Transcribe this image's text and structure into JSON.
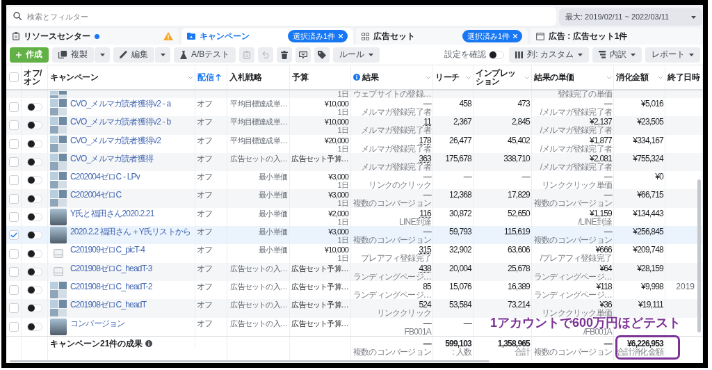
{
  "search": {
    "placeholder": "検索とフィルター"
  },
  "date_range": {
    "label": "最大: 2019/02/11 ~ 2022/03/11"
  },
  "tabs": [
    {
      "kind": "resources",
      "label": "リソースセンター",
      "selected": false,
      "notice": true,
      "warning": true
    },
    {
      "kind": "campaigns",
      "label": "キャンペーン",
      "selected": true,
      "notice": false,
      "warning": false,
      "badge": "選択済み1件"
    },
    {
      "kind": "adsets",
      "label": "広告セット",
      "selected": false,
      "notice": false,
      "warning": false,
      "badge": "選択済み1件"
    },
    {
      "kind": "ads",
      "label": "広告 : 広告セット1件",
      "selected": false,
      "notice": false,
      "warning": false
    }
  ],
  "toolbar": {
    "actions": [
      {
        "kind": "create",
        "label": "作成",
        "caret": false,
        "disabled": false
      },
      {
        "kind": "duplicate",
        "label": "複製",
        "caret": false,
        "disabled": false
      },
      {
        "kind": "dropdown",
        "disabled": false
      },
      {
        "kind": "edit",
        "label": "編集",
        "caret": false,
        "disabled": false
      },
      {
        "kind": "dropdown",
        "disabled": false
      },
      {
        "kind": "abtest",
        "label": "A/Bテスト",
        "caret": false,
        "disabled": false
      },
      {
        "kind": "clipboard",
        "caret": false,
        "disabled": true
      },
      {
        "kind": "undo",
        "caret": false,
        "disabled": true
      },
      {
        "kind": "delete",
        "caret": false,
        "disabled": false
      },
      {
        "kind": "comment",
        "caret": false,
        "disabled": false
      },
      {
        "kind": "tag",
        "caret": false,
        "disabled": false
      },
      {
        "kind": "rules",
        "label": "ルール",
        "caret": true,
        "disabled": false
      }
    ],
    "review": {
      "label": "設定を確認",
      "on": false
    },
    "views": [
      {
        "kind": "columns",
        "label": "列: カスタム"
      },
      {
        "kind": "breakdown",
        "label": "内訳"
      },
      {
        "kind": "reports",
        "label": "レポート"
      }
    ]
  },
  "table": {
    "select_all": {
      "checked": false
    },
    "columns": [
      {
        "label": "オフ/オン",
        "menu": false,
        "sorted": false,
        "info": false
      },
      {
        "label": "キャンペーン",
        "menu": true,
        "sorted": false,
        "info": false
      },
      {
        "label": "配信",
        "menu": false,
        "sorted": true,
        "info": false
      },
      {
        "label": "入札戦略",
        "menu": false,
        "sorted": false,
        "info": false
      },
      {
        "label": "予算",
        "menu": false,
        "sorted": false,
        "info": false
      },
      {
        "label": "結果",
        "menu": true,
        "sorted": false,
        "info": true
      },
      {
        "label": "リーチ",
        "menu": true,
        "sorted": false,
        "info": false
      },
      {
        "label": "インプレッション",
        "menu": true,
        "sorted": false,
        "info": false
      },
      {
        "label": "結果の単価",
        "menu": true,
        "sorted": false,
        "info": false
      },
      {
        "label": "消化金額",
        "menu": true,
        "sorted": false,
        "info": false
      },
      {
        "label": "終了日時",
        "menu": false,
        "sorted": false,
        "info": false
      }
    ],
    "cut_row": {
      "thumbnail": {
        "kind": "grid"
      },
      "budget": {
        "note": "1日"
      },
      "result": {
        "note": "ウェブサイトの登録…"
      },
      "cost": {
        "note": "登録完了の単価"
      }
    },
    "rows": [
      {
        "selected": false,
        "on": false,
        "thumbnail": {
          "kind": "grid"
        },
        "name": "CVO_メルマガ読者獲得v2 - a",
        "delivery": "オフ",
        "bid": "平均目標達成単…",
        "budget": {
          "value": "¥10,000",
          "note": "1日"
        },
        "result": {
          "value": "—",
          "note": "メルマガ登録完了者",
          "linked": false
        },
        "reach": "458",
        "impressions": "473",
        "cost": {
          "value": "—",
          "note": "/メルマガ登録完了者"
        },
        "spent": "¥5,016"
      },
      {
        "selected": false,
        "on": false,
        "thumbnail": {
          "kind": "grid"
        },
        "name": "CVO_メルマガ読者獲得v2 - b",
        "delivery": "オフ",
        "bid": "平均目標達成単…",
        "budget": {
          "value": "¥10,000",
          "note": "1日"
        },
        "result": {
          "value": "11",
          "note": "メルマガ登録完了者",
          "linked": true
        },
        "reach": "2,367",
        "impressions": "2,845",
        "cost": {
          "value": "¥2,137",
          "note": "/メルマガ登録完了者"
        },
        "spent": "¥23,505"
      },
      {
        "selected": false,
        "on": false,
        "thumbnail": {
          "kind": "grid"
        },
        "name": "CVO_メルマガ読者獲得v2",
        "delivery": "オフ",
        "bid": "平均目標達成単…",
        "budget": {
          "value": "¥20,000",
          "note": "1日"
        },
        "result": {
          "value": "178",
          "note": "メルマガ登録完了者",
          "linked": true
        },
        "reach": "26,477",
        "impressions": "45,402",
        "cost": {
          "value": "¥1,877",
          "note": "/メルマガ登録完了者"
        },
        "spent": "¥334,167"
      },
      {
        "selected": false,
        "on": false,
        "thumbnail": {
          "kind": "grid"
        },
        "name": "CVO_メルマガ読者獲得",
        "delivery": "オフ",
        "bid": "広告セットの入…",
        "budget": {
          "value": "広告セット予算…"
        },
        "result": {
          "value": "363",
          "note": "メルマガ登録完了者",
          "linked": true
        },
        "reach": "175,678",
        "impressions": "338,710",
        "cost": {
          "value": "¥2,081",
          "note": "/メルマガ登録完了者"
        },
        "spent": "¥755,324"
      },
      {
        "selected": false,
        "on": false,
        "thumbnail": {
          "kind": "grid"
        },
        "name": "C202004ゼロC - LPv",
        "delivery": "オフ",
        "bid": "最小単価",
        "budget": {
          "value": "¥3,000",
          "note": "1日"
        },
        "result": {
          "value": "—",
          "note": "リンクのクリック",
          "linked": false
        },
        "reach": "—",
        "impressions": "—",
        "cost": {
          "value": "—",
          "note": "リンククリック単価"
        },
        "spent": "¥0"
      },
      {
        "selected": false,
        "on": false,
        "thumbnail": {
          "kind": "grid"
        },
        "name": "C202004ゼロC",
        "delivery": "オフ",
        "bid": "最小単価",
        "budget": {
          "value": "¥3,000",
          "note": "1日"
        },
        "result": {
          "value": "—",
          "note": "複数のコンバージョン",
          "linked": false
        },
        "reach": "12,368",
        "impressions": "17,829",
        "cost": {
          "value": "—",
          "note": "複数のコンバージョン"
        },
        "spent": "¥66,715"
      },
      {
        "selected": false,
        "on": false,
        "thumbnail": {
          "kind": "photo"
        },
        "name": "Y氏と福田さん2020.2.21",
        "delivery": "オフ",
        "bid": "最小単価",
        "budget": {
          "value": "¥2,000",
          "note": "1日"
        },
        "result": {
          "value": "116",
          "note": "LINE到達",
          "linked": true
        },
        "reach": "30,872",
        "impressions": "52,650",
        "cost": {
          "value": "¥1,159",
          "note": "/LINE到達"
        },
        "spent": "¥134,443"
      },
      {
        "selected": true,
        "on": false,
        "thumbnail": {
          "kind": "photo"
        },
        "name": "2020.2.2 福田さん＋Y氏リストから",
        "delivery": "オフ",
        "bid": "最小単価",
        "budget": {
          "value": "¥3,000",
          "note": "1日"
        },
        "result": {
          "value": "—",
          "note": "複数のコンバージョン",
          "linked": false
        },
        "reach": "59,793",
        "impressions": "115,619",
        "cost": {
          "value": "—",
          "note": "複数のコンバージョン"
        },
        "spent": "¥256,845"
      },
      {
        "selected": false,
        "on": false,
        "thumbnail": {
          "kind": "empty"
        },
        "name": "C201909ゼロC_picT-4",
        "delivery": "オフ",
        "bid": "最小単価",
        "budget": {
          "value": "¥10,000",
          "note": "1日"
        },
        "result": {
          "value": "315",
          "note": "プレアフィ登録完了",
          "linked": true
        },
        "reach": "32,902",
        "impressions": "63,606",
        "cost": {
          "value": "¥666",
          "note": "/プレアフィ登録完了"
        },
        "spent": "¥209,748"
      },
      {
        "selected": false,
        "on": false,
        "thumbnail": {
          "kind": "empty"
        },
        "name": "C201908ゼロC_headT-3",
        "delivery": "オフ",
        "bid": "広告セットの入…",
        "budget": {
          "value": "広告セット予算…"
        },
        "result": {
          "value": "438",
          "note": "ランディングページ…",
          "linked": true
        },
        "reach": "20,004",
        "impressions": "25,678",
        "cost": {
          "value": "¥64",
          "note": "ランディングページ…"
        },
        "spent": "¥28,159"
      },
      {
        "selected": false,
        "on": false,
        "thumbnail": {
          "kind": "grid"
        },
        "name": "C201908ゼロC_headT-2",
        "delivery": "オフ",
        "bid": "広告セットの入…",
        "budget": {
          "value": "広告セット予算…"
        },
        "result": {
          "value": "85",
          "note": "ランディングページ…",
          "linked": false
        },
        "reach": "15,076",
        "impressions": "16,389",
        "cost": {
          "value": "¥118",
          "note": "ランディングページ…"
        },
        "spent": "¥9,998",
        "end": "2019"
      },
      {
        "selected": false,
        "on": false,
        "thumbnail": {
          "kind": "grid"
        },
        "name": "C201908ゼロC_headT",
        "delivery": "オフ",
        "bid": "広告セットの入…",
        "budget": {
          "value": "広告セット予算…"
        },
        "result": {
          "value": "524",
          "note": "リンククリック",
          "linked": false
        },
        "reach": "53,584",
        "impressions": "73,214",
        "cost": {
          "value": "¥36",
          "note": "リンククリック単価"
        },
        "spent": "¥19,111"
      },
      {
        "selected": false,
        "on": false,
        "thumbnail": {
          "kind": "photo"
        },
        "name": "コンバージョン",
        "delivery": "オフ",
        "bid": "広告セットの入…",
        "budget": {
          "value": "広告セット予算…"
        },
        "result": {
          "value": "—",
          "note": "FB001A",
          "linked": false
        },
        "reach": "—",
        "cost": {
          "note": "/FB001A"
        }
      }
    ],
    "summary": {
      "label": "キャンペーン21件の成果",
      "info": true,
      "result": {
        "value": "—",
        "note": "複数のコンバージョン"
      },
      "reach": {
        "value": "599,103",
        "note": ": 人数"
      },
      "impressions": {
        "value": "1,358,965",
        "note": "合計"
      },
      "cost": {
        "value": "—",
        "note": "複数のコンバージョン"
      },
      "spent": {
        "value": "¥6,226,953",
        "note": "合計消化金額",
        "circled": true
      }
    }
  },
  "annotation": {
    "text": "1アカウントで600万円ほどテスト"
  }
}
